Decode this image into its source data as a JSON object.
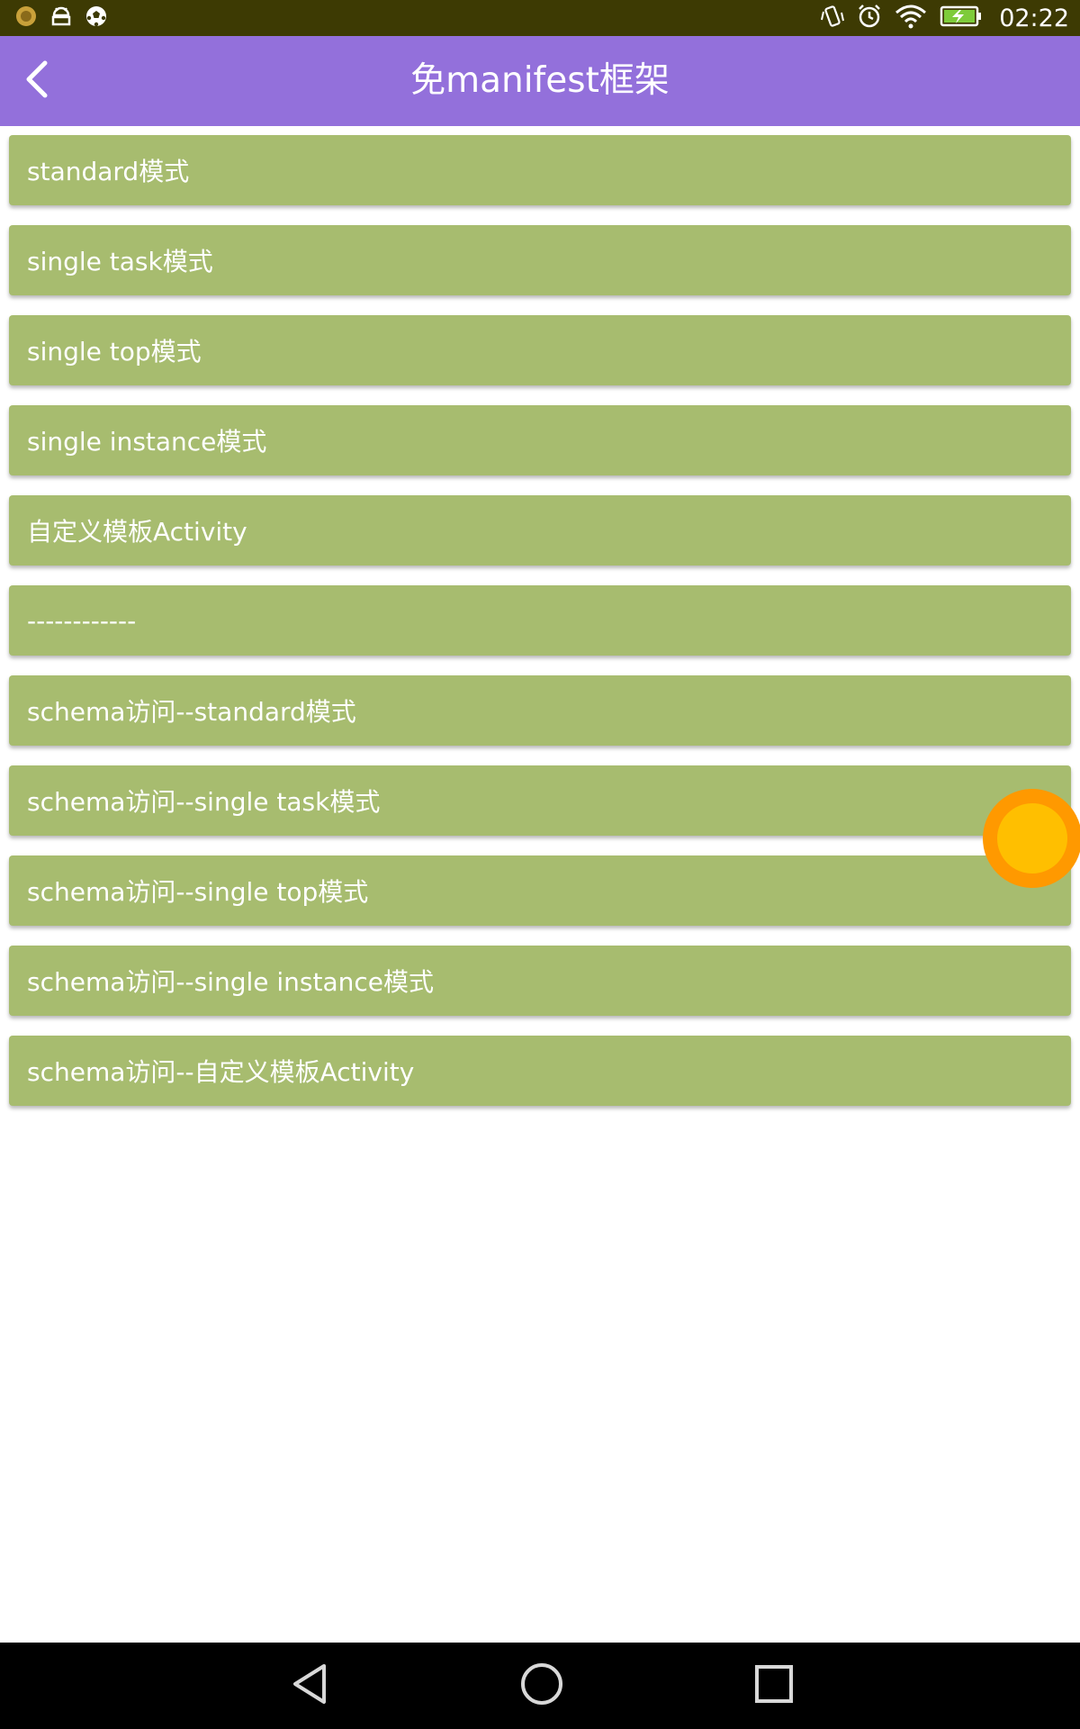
{
  "status_bar": {
    "time": "02:22",
    "icons_left": [
      "sun-icon",
      "android-icon",
      "soccer-ball-icon"
    ],
    "icons_right": [
      "vibrate-icon",
      "alarm-icon",
      "wifi-icon",
      "battery-charging-icon"
    ]
  },
  "toolbar": {
    "title": "免manifest框架",
    "back_icon": "chevron-left-icon"
  },
  "list": {
    "items": [
      {
        "label": "standard模式"
      },
      {
        "label": "single task模式"
      },
      {
        "label": "single top模式"
      },
      {
        "label": "single instance模式"
      },
      {
        "label": "自定义模板Activity"
      },
      {
        "label": "------------"
      },
      {
        "label": "schema访问--standard模式"
      },
      {
        "label": "schema访问--single task模式"
      },
      {
        "label": "schema访问--single top模式"
      },
      {
        "label": "schema访问--single instance模式"
      },
      {
        "label": "schema访问--自定义模板Activity"
      }
    ]
  },
  "nav_bar": {
    "icons": [
      "back-triangle-icon",
      "home-circle-icon",
      "recents-square-icon"
    ]
  },
  "colors": {
    "status_bar": "#3d3a03",
    "toolbar": "#9370db",
    "list_item": "#a7bc6f",
    "touch_indicator_fill": "#ffbf00",
    "touch_indicator_ring": "#ff9900"
  }
}
